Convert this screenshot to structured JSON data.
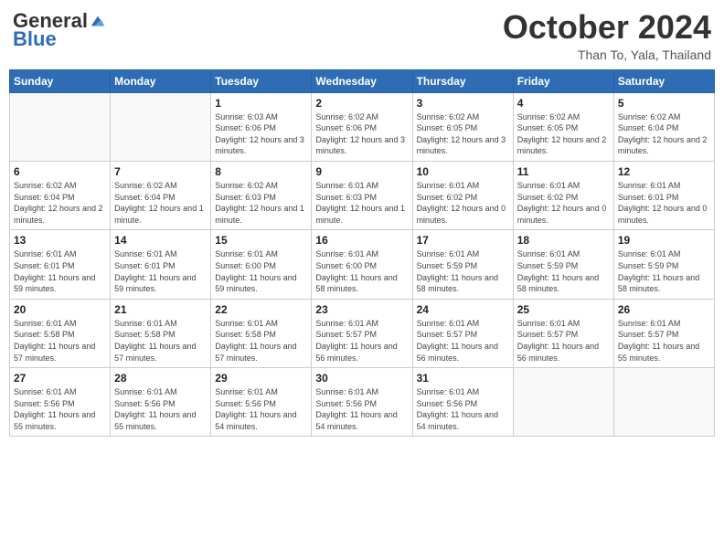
{
  "logo": {
    "general": "General",
    "blue": "Blue"
  },
  "title": "October 2024",
  "location": "Than To, Yala, Thailand",
  "days_header": [
    "Sunday",
    "Monday",
    "Tuesday",
    "Wednesday",
    "Thursday",
    "Friday",
    "Saturday"
  ],
  "weeks": [
    [
      {
        "day": "",
        "info": ""
      },
      {
        "day": "",
        "info": ""
      },
      {
        "day": "1",
        "info": "Sunrise: 6:03 AM\nSunset: 6:06 PM\nDaylight: 12 hours and 3 minutes."
      },
      {
        "day": "2",
        "info": "Sunrise: 6:02 AM\nSunset: 6:06 PM\nDaylight: 12 hours and 3 minutes."
      },
      {
        "day": "3",
        "info": "Sunrise: 6:02 AM\nSunset: 6:05 PM\nDaylight: 12 hours and 3 minutes."
      },
      {
        "day": "4",
        "info": "Sunrise: 6:02 AM\nSunset: 6:05 PM\nDaylight: 12 hours and 2 minutes."
      },
      {
        "day": "5",
        "info": "Sunrise: 6:02 AM\nSunset: 6:04 PM\nDaylight: 12 hours and 2 minutes."
      }
    ],
    [
      {
        "day": "6",
        "info": "Sunrise: 6:02 AM\nSunset: 6:04 PM\nDaylight: 12 hours and 2 minutes."
      },
      {
        "day": "7",
        "info": "Sunrise: 6:02 AM\nSunset: 6:04 PM\nDaylight: 12 hours and 1 minute."
      },
      {
        "day": "8",
        "info": "Sunrise: 6:02 AM\nSunset: 6:03 PM\nDaylight: 12 hours and 1 minute."
      },
      {
        "day": "9",
        "info": "Sunrise: 6:01 AM\nSunset: 6:03 PM\nDaylight: 12 hours and 1 minute."
      },
      {
        "day": "10",
        "info": "Sunrise: 6:01 AM\nSunset: 6:02 PM\nDaylight: 12 hours and 0 minutes."
      },
      {
        "day": "11",
        "info": "Sunrise: 6:01 AM\nSunset: 6:02 PM\nDaylight: 12 hours and 0 minutes."
      },
      {
        "day": "12",
        "info": "Sunrise: 6:01 AM\nSunset: 6:01 PM\nDaylight: 12 hours and 0 minutes."
      }
    ],
    [
      {
        "day": "13",
        "info": "Sunrise: 6:01 AM\nSunset: 6:01 PM\nDaylight: 11 hours and 59 minutes."
      },
      {
        "day": "14",
        "info": "Sunrise: 6:01 AM\nSunset: 6:01 PM\nDaylight: 11 hours and 59 minutes."
      },
      {
        "day": "15",
        "info": "Sunrise: 6:01 AM\nSunset: 6:00 PM\nDaylight: 11 hours and 59 minutes."
      },
      {
        "day": "16",
        "info": "Sunrise: 6:01 AM\nSunset: 6:00 PM\nDaylight: 11 hours and 58 minutes."
      },
      {
        "day": "17",
        "info": "Sunrise: 6:01 AM\nSunset: 5:59 PM\nDaylight: 11 hours and 58 minutes."
      },
      {
        "day": "18",
        "info": "Sunrise: 6:01 AM\nSunset: 5:59 PM\nDaylight: 11 hours and 58 minutes."
      },
      {
        "day": "19",
        "info": "Sunrise: 6:01 AM\nSunset: 5:59 PM\nDaylight: 11 hours and 58 minutes."
      }
    ],
    [
      {
        "day": "20",
        "info": "Sunrise: 6:01 AM\nSunset: 5:58 PM\nDaylight: 11 hours and 57 minutes."
      },
      {
        "day": "21",
        "info": "Sunrise: 6:01 AM\nSunset: 5:58 PM\nDaylight: 11 hours and 57 minutes."
      },
      {
        "day": "22",
        "info": "Sunrise: 6:01 AM\nSunset: 5:58 PM\nDaylight: 11 hours and 57 minutes."
      },
      {
        "day": "23",
        "info": "Sunrise: 6:01 AM\nSunset: 5:57 PM\nDaylight: 11 hours and 56 minutes."
      },
      {
        "day": "24",
        "info": "Sunrise: 6:01 AM\nSunset: 5:57 PM\nDaylight: 11 hours and 56 minutes."
      },
      {
        "day": "25",
        "info": "Sunrise: 6:01 AM\nSunset: 5:57 PM\nDaylight: 11 hours and 56 minutes."
      },
      {
        "day": "26",
        "info": "Sunrise: 6:01 AM\nSunset: 5:57 PM\nDaylight: 11 hours and 55 minutes."
      }
    ],
    [
      {
        "day": "27",
        "info": "Sunrise: 6:01 AM\nSunset: 5:56 PM\nDaylight: 11 hours and 55 minutes."
      },
      {
        "day": "28",
        "info": "Sunrise: 6:01 AM\nSunset: 5:56 PM\nDaylight: 11 hours and 55 minutes."
      },
      {
        "day": "29",
        "info": "Sunrise: 6:01 AM\nSunset: 5:56 PM\nDaylight: 11 hours and 54 minutes."
      },
      {
        "day": "30",
        "info": "Sunrise: 6:01 AM\nSunset: 5:56 PM\nDaylight: 11 hours and 54 minutes."
      },
      {
        "day": "31",
        "info": "Sunrise: 6:01 AM\nSunset: 5:56 PM\nDaylight: 11 hours and 54 minutes."
      },
      {
        "day": "",
        "info": ""
      },
      {
        "day": "",
        "info": ""
      }
    ]
  ]
}
